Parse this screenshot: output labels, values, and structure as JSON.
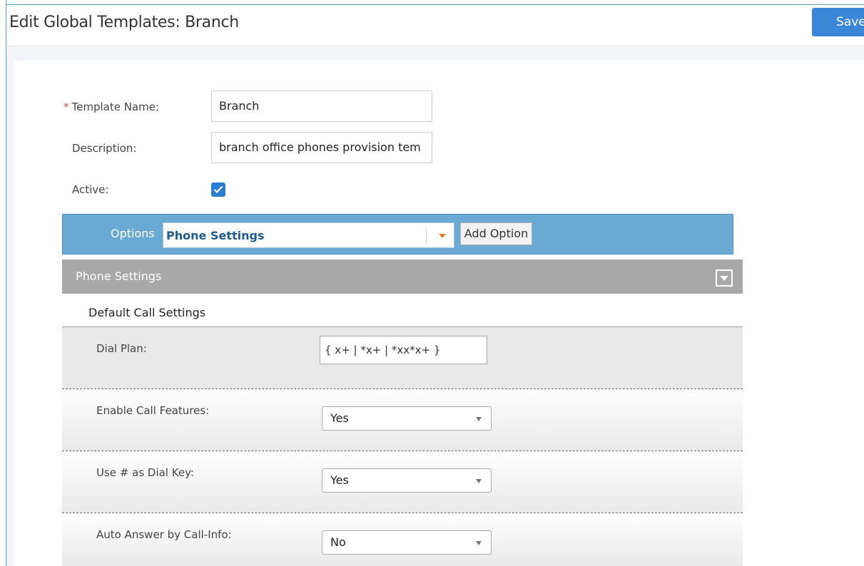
{
  "header": {
    "title": "Edit Global Templates: Branch",
    "save_label": "Save"
  },
  "form": {
    "template_name_label": "Template Name:",
    "template_name_required": "*",
    "template_name_value": "Branch",
    "description_label": "Description:",
    "description_value": "branch office phones provision tem",
    "active_label": "Active:",
    "active_checked": true
  },
  "options_bar": {
    "label": "Options",
    "selected": "Phone Settings",
    "add_option_label": "Add Option"
  },
  "section": {
    "title": "Phone Settings",
    "subsection_title": "Default Call Settings",
    "settings": [
      {
        "label": "Dial Plan:",
        "value": "{ x+ | *x+ | *xx*x+ }",
        "control": "text"
      },
      {
        "label": "Enable Call Features:",
        "value": "Yes",
        "control": "select"
      },
      {
        "label": "Use # as Dial Key:",
        "value": "Yes",
        "control": "select"
      },
      {
        "label": "Auto Answer by Call-Info:",
        "value": "No",
        "control": "select"
      }
    ]
  },
  "colors": {
    "accent": "#3b86d6",
    "options_bar": "#6aa9d3",
    "section_header": "#a8a8a8",
    "required": "#d9534f",
    "caret": "#e07a1a"
  }
}
